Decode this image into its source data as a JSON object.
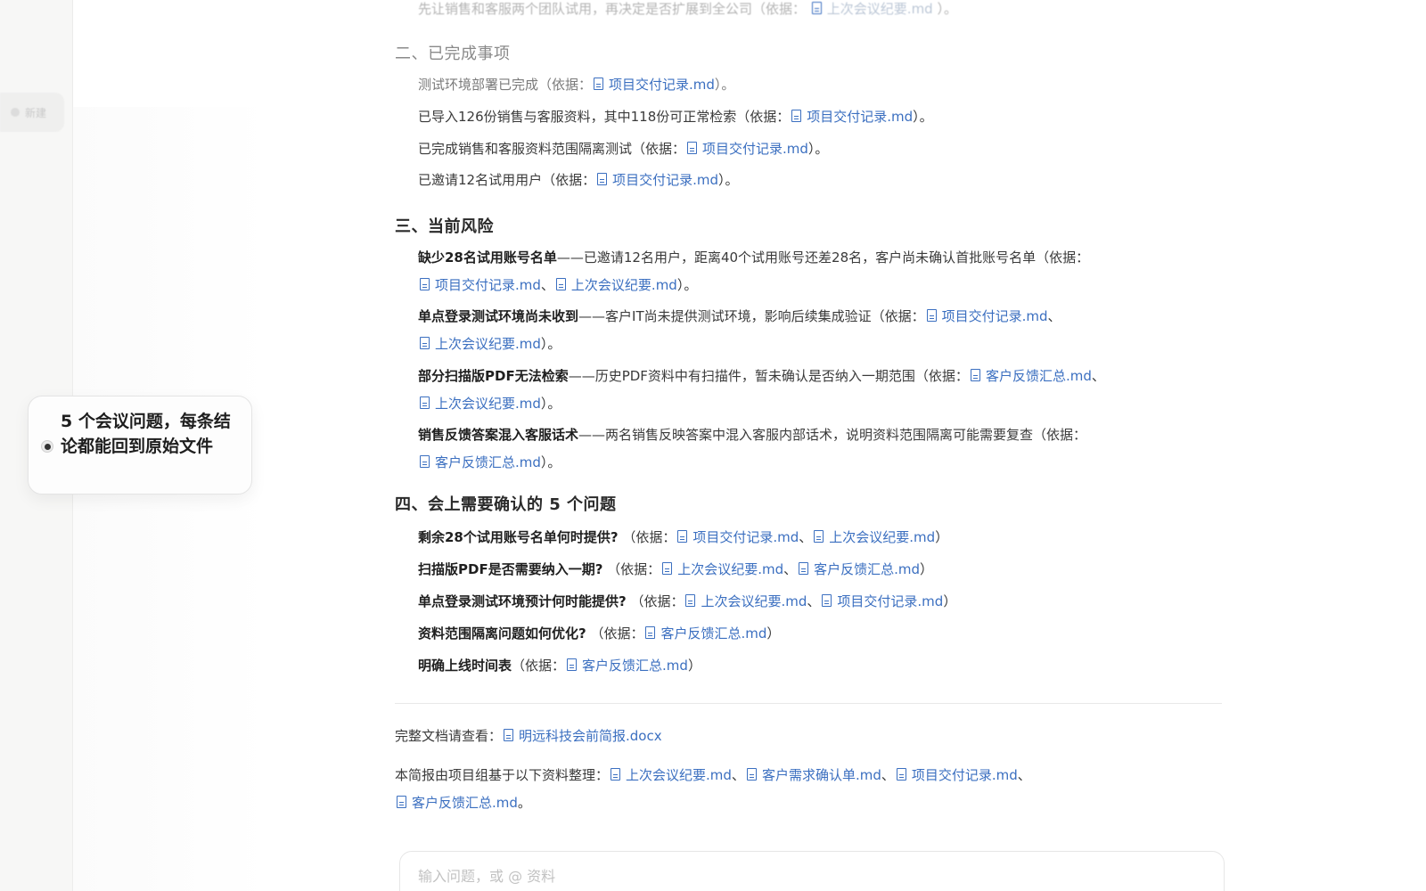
{
  "sidebar": {
    "active_item_label": "新建"
  },
  "doc": {
    "top_line_text": "先让销售和客服两个团队试用，再决定是否扩展到全公司（依据：",
    "top_line_ref": "上次会议纪要.md",
    "top_line_end": "）。",
    "section2_title": "二、已完成事项",
    "section2_items": [
      {
        "text": "测试环境部署已完成（依据：",
        "refs": [
          "项目交付记录.md"
        ],
        "end": "）。"
      },
      {
        "text": "已导入126份销售与客服资料，其中118份可正常检索（依据：",
        "refs": [
          "项目交付记录.md"
        ],
        "end": "）。"
      },
      {
        "text": "已完成销售和客服资料范围隔离测试（依据：",
        "refs": [
          "项目交付记录.md"
        ],
        "end": "）。"
      },
      {
        "text": "已邀请12名试用用户（依据：",
        "refs": [
          "项目交付记录.md"
        ],
        "end": "）。"
      }
    ],
    "section3_title": "三、当前风险",
    "section3_items": [
      {
        "bold": "缺少28名试用账号名单",
        "text": "——已邀请12名用户，距离40个试用账号还差28名，客户尚未确认首批账号名单（依据：",
        "refs_line2": [
          "项目交付记录.md",
          "上次会议纪要.md"
        ],
        "end": "）。"
      },
      {
        "bold": "单点登录测试环境尚未收到",
        "text": "——客户IT尚未提供测试环境，影响后续集成验证（依据：",
        "ref_line1": "项目交付记录.md",
        "refs_line2": [
          "上次会议纪要.md"
        ],
        "end": "）。"
      },
      {
        "bold": "部分扫描版PDF无法检索",
        "text": "——历史PDF资料中有扫描件，暂未确认是否纳入一期范围（依据：",
        "ref_line1": "客户反馈汇总.md",
        "refs_line2": [
          "上次会议纪要.md"
        ],
        "end": "）。"
      },
      {
        "bold": "销售反馈答案混入客服话术",
        "text": "——两名销售反映答案中混入客服内部话术，说明资料范围隔离可能需要复查（依据：",
        "refs_line2": [
          "客户反馈汇总.md"
        ],
        "end": "）。"
      }
    ],
    "section4_title": "四、会上需要确认的 5 个问题",
    "section4_items": [
      {
        "bold": "剩余28个试用账号名单何时提供?",
        "text": " （依据：",
        "refs": [
          "项目交付记录.md",
          "上次会议纪要.md"
        ],
        "end": "）"
      },
      {
        "bold": "扫描版PDF是否需要纳入一期?",
        "text": " （依据：",
        "refs": [
          "上次会议纪要.md",
          "客户反馈汇总.md"
        ],
        "end": "）"
      },
      {
        "bold": "单点登录测试环境预计何时能提供?",
        "text": " （依据：",
        "refs": [
          "上次会议纪要.md",
          "项目交付记录.md"
        ],
        "end": "）"
      },
      {
        "bold": "资料范围隔离问题如何优化?",
        "text": " （依据：",
        "refs": [
          "客户反馈汇总.md"
        ],
        "end": "）"
      },
      {
        "bold": "明确上线时间表",
        "text": "（依据：",
        "refs": [
          "客户反馈汇总.md"
        ],
        "end": "）"
      }
    ],
    "full_doc_label": "完整文档请查看：",
    "full_doc_ref": "明远科技会前简报.docx",
    "source_label": "本简报由项目组基于以下资料整理：",
    "source_refs_line1": [
      "上次会议纪要.md",
      "客户需求确认单.md",
      "项目交付记录.md"
    ],
    "source_refs_line2": [
      "客户反馈汇总.md"
    ],
    "source_end": "。"
  },
  "input": {
    "placeholder": "输入问题，或 @ 资料"
  },
  "callout": {
    "text": "5 个会议问题，每条结论都能回到原始文件"
  }
}
